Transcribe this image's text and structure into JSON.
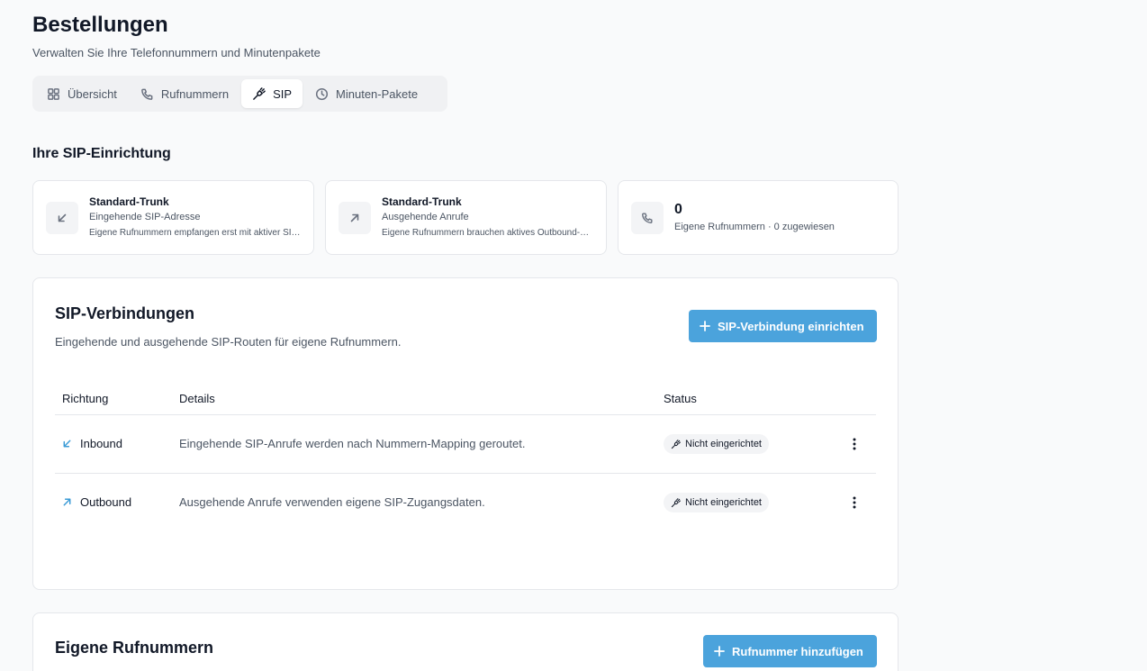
{
  "header": {
    "title": "Bestellungen",
    "subtitle": "Verwalten Sie Ihre Telefonnummern und Minutenpakete"
  },
  "tabs": [
    {
      "label": "Übersicht",
      "icon": "grid-icon",
      "active": false
    },
    {
      "label": "Rufnummern",
      "icon": "phone-icon",
      "active": false
    },
    {
      "label": "SIP",
      "icon": "plug-icon",
      "active": true
    },
    {
      "label": "Minuten-Pakete",
      "icon": "clock-icon",
      "active": false
    }
  ],
  "setup": {
    "title": "Ihre SIP-Einrichtung",
    "cards": [
      {
        "title": "Standard-Trunk",
        "subtitle": "Eingehende SIP-Adresse",
        "note": "Eigene Rufnummern empfangen erst mit aktiver SIP-Verbindung Anrufe.",
        "icon": "arrow-down-left-icon"
      },
      {
        "title": "Standard-Trunk",
        "subtitle": "Ausgehende Anrufe",
        "note": "Eigene Rufnummern brauchen aktives Outbound-Routing für Anrufe.",
        "icon": "arrow-up-right-icon"
      },
      {
        "value": "0",
        "subtitle": "Eigene Rufnummern · 0 zugewiesen",
        "icon": "phone-icon"
      }
    ]
  },
  "connections": {
    "title": "SIP-Verbindungen",
    "description": "Eingehende und ausgehende SIP-Routen für eigene Rufnummern.",
    "add_button": "SIP-Verbindung einrichten",
    "columns": [
      "Richtung",
      "Details",
      "Status"
    ],
    "rows": [
      {
        "direction": "Inbound",
        "details": "Eingehende SIP-Anrufe werden nach Nummern-Mapping geroutet.",
        "status": "Nicht eingerichtet"
      },
      {
        "direction": "Outbound",
        "details": "Ausgehende Anrufe verwenden eigene SIP-Zugangsdaten.",
        "status": "Nicht eingerichtet"
      }
    ]
  },
  "numbers": {
    "title": "Eigene Rufnummern",
    "add_button": "Rufnummer hinzufügen"
  },
  "colors": {
    "accent": "#4ba3dc",
    "background": "#f9fafb",
    "border": "#e5e7eb"
  }
}
